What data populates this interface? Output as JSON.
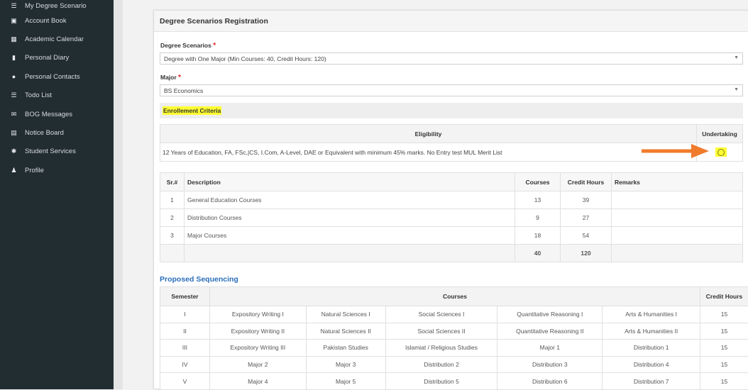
{
  "sidebar": {
    "items": [
      {
        "label": "My Degree Scenario",
        "icon": "list-icon"
      },
      {
        "label": "Account Book",
        "icon": "money-icon"
      },
      {
        "label": "Academic Calendar",
        "icon": "calendar-icon"
      },
      {
        "label": "Personal Diary",
        "icon": "book-icon"
      },
      {
        "label": "Personal Contacts",
        "icon": "users-icon"
      },
      {
        "label": "Todo List",
        "icon": "list-icon"
      },
      {
        "label": "BOG Messages",
        "icon": "envelope-icon"
      },
      {
        "label": "Notice Board",
        "icon": "clipboard-icon"
      },
      {
        "label": "Student Services",
        "icon": "cogs-icon"
      },
      {
        "label": "Profile",
        "icon": "user-icon"
      }
    ]
  },
  "panel": {
    "title": "Degree Scenarios Registration",
    "degree_label": "Degree Scenarios",
    "degree_value": "Degree with One Major (Min Courses: 40, Credit Hours: 120)",
    "major_label": "Major",
    "major_value": "BS Economics",
    "required_mark": "*",
    "criteria_label": "Enrollement Criteria"
  },
  "eligibility": {
    "headers": {
      "eligibility": "Eligibility",
      "undertaking": "Undertaking"
    },
    "text": "12 Years of Education, FA, FSc,|CS, I.Com, A-Level, DAE or Equivalent with minimum 45% marks. No Entry test MUL Merit List"
  },
  "summary": {
    "headers": {
      "sr": "Sr.#",
      "description": "Description",
      "courses": "Courses",
      "credit_hours": "Credit Hours",
      "remarks": "Remarks"
    },
    "rows": [
      {
        "sr": "1",
        "description": "General Education Courses",
        "courses": "13",
        "credit_hours": "39",
        "remarks": ""
      },
      {
        "sr": "2",
        "description": "Distribution Courses",
        "courses": "9",
        "credit_hours": "27",
        "remarks": ""
      },
      {
        "sr": "3",
        "description": "Major Courses",
        "courses": "18",
        "credit_hours": "54",
        "remarks": ""
      }
    ],
    "total": {
      "courses": "40",
      "credit_hours": "120"
    }
  },
  "sequencing": {
    "title": "Proposed Sequencing",
    "headers": {
      "semester": "Semester",
      "courses": "Courses",
      "credit_hours": "Credit Hours"
    },
    "rows": [
      {
        "semester": "I",
        "c1": "Expository Writing I",
        "c2": "Natural Sciences I",
        "c3": "Social Sciences I",
        "c4": "Quantitative Reasoning I",
        "c5": "Arts & Humanities I",
        "credit": "15"
      },
      {
        "semester": "II",
        "c1": "Expository Writing II",
        "c2": "Natural Sciences II",
        "c3": "Social Sciences II",
        "c4": "Quantitative Reasoning II",
        "c5": "Arts & Humanities II",
        "credit": "15"
      },
      {
        "semester": "III",
        "c1": "Expository Writing III",
        "c2": "Pakistan Studies",
        "c3": "Islamiat / Religious Studies",
        "c4": "Major 1",
        "c5": "Distribution 1",
        "credit": "15"
      },
      {
        "semester": "IV",
        "c1": "Major 2",
        "c2": "Major 3",
        "c3": "Distribution 2",
        "c4": "Distribution 3",
        "c5": "Distribution 4",
        "credit": "15"
      },
      {
        "semester": "V",
        "c1": "Major 4",
        "c2": "Major 5",
        "c3": "Distribution 5",
        "c4": "Distribution 6",
        "c5": "Distribution 7",
        "credit": "15"
      }
    ]
  },
  "colors": {
    "sidebar_bg": "#222d32",
    "highlight": "#ffff32",
    "arrow": "#f07b2c",
    "link_blue": "#2a6ebb",
    "total_blue": "#2a55c7"
  }
}
